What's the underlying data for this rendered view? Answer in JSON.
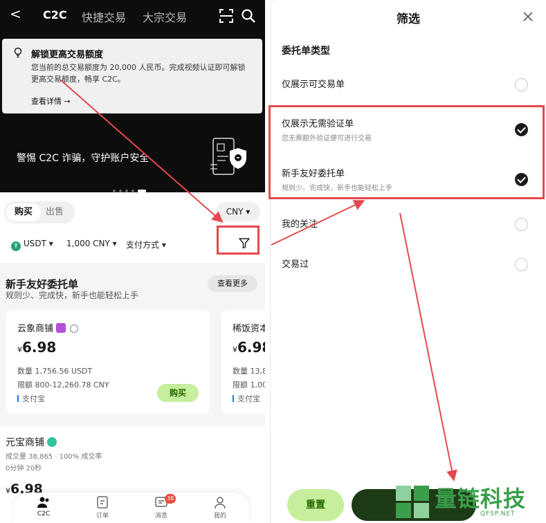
{
  "left": {
    "nav": {
      "back": "<",
      "tab_c2c": "C2C",
      "tab_quick": "快捷交易",
      "tab_bulk": "大宗交易"
    },
    "unlock_card": {
      "title": "解锁更高交易额度",
      "desc": "您当前的总交易额度为 20,000 人民币。完成视频认证即可解锁更高交易额度，畅享 C2C。",
      "link": "查看详情 →"
    },
    "banner": {
      "text": "警惕 C2C 诈骗，守护账户安全"
    },
    "trade": {
      "buy": "购买",
      "sell": "出售",
      "currency": "CNY ▾",
      "coin": "USDT ▾",
      "amount": "1,000 CNY ▾",
      "payment": "支付方式 ▾"
    },
    "friendly": {
      "title": "新手友好委托单",
      "subtitle": "规则少、完成快，新手也能轻松上手",
      "see_more": "查看更多",
      "cards": [
        {
          "name": "云象商铺",
          "currency_symbol": "¥",
          "price": "6.98",
          "qty": "数量 1,756.56 USDT",
          "limit": "限额 800-12,260.78 CNY",
          "pay": "支付宝",
          "buy": "购买"
        },
        {
          "name": "稀饭资本",
          "currency_symbol": "¥",
          "price": "6.98",
          "qty": "数量 13,8",
          "limit": "限额 1,00",
          "pay": "支付宝"
        }
      ]
    },
    "merchant2": {
      "name": "元宝商铺",
      "stats": "成交量 38,865 · 100% 成交率",
      "time": "0分钟 20秒",
      "currency_symbol": "¥",
      "price": "6.98"
    },
    "tabs": {
      "c2c": "C2C",
      "order": "订单",
      "msg": "消息",
      "me": "我的",
      "msg_badge": "38"
    }
  },
  "right": {
    "title": "筛选",
    "section": "委托单类型",
    "options": [
      {
        "label": "仅展示可交易单",
        "sub": "",
        "checked": false
      },
      {
        "label": "仅展示无需验证单",
        "sub": "您无需额外验证便可进行交易",
        "checked": true
      },
      {
        "label": "新手友好委托单",
        "sub": "规则少、完成快，新手也能轻松上手",
        "checked": true
      },
      {
        "label": "我的关注",
        "sub": "",
        "checked": false
      },
      {
        "label": "交易过",
        "sub": "",
        "checked": false
      }
    ],
    "reset": "重置"
  },
  "watermark": {
    "text": "量链科技",
    "sub": "QFSP.NET"
  },
  "colors": {
    "accent_green": "#c6ee9c",
    "annotation_red": "#e5484d",
    "dark_button": "#1d3b14"
  }
}
